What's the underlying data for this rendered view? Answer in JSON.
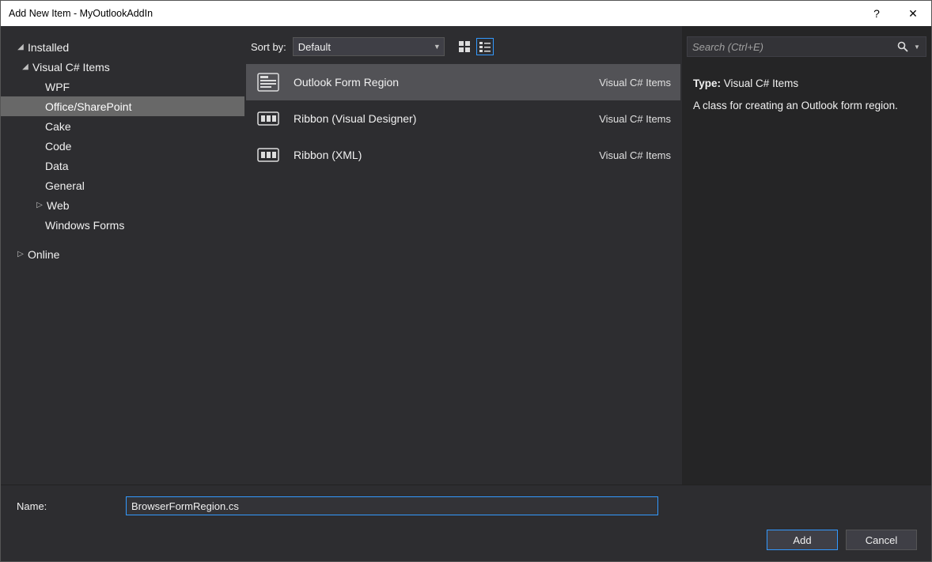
{
  "titlebar": {
    "title": "Add New Item - MyOutlookAddIn",
    "help": "?",
    "close": "✕"
  },
  "sidebar": {
    "installed": "Installed",
    "csharp": "Visual C# Items",
    "items": [
      "WPF",
      "Office/SharePoint",
      "Cake",
      "Code",
      "Data",
      "General",
      "Web",
      "Windows Forms"
    ],
    "online": "Online"
  },
  "toolbar": {
    "sort_label": "Sort by:",
    "sort_value": "Default"
  },
  "templates": [
    {
      "name": "Outlook Form Region",
      "type": "Visual C# Items",
      "selected": true
    },
    {
      "name": "Ribbon (Visual Designer)",
      "type": "Visual C# Items",
      "selected": false
    },
    {
      "name": "Ribbon (XML)",
      "type": "Visual C# Items",
      "selected": false
    }
  ],
  "search": {
    "placeholder": "Search (Ctrl+E)"
  },
  "details": {
    "type_label": "Type:",
    "type_value": "Visual C# Items",
    "description": "A class for creating an Outlook form region."
  },
  "footer": {
    "name_label": "Name:",
    "name_value": "BrowserFormRegion.cs",
    "add": "Add",
    "cancel": "Cancel"
  }
}
